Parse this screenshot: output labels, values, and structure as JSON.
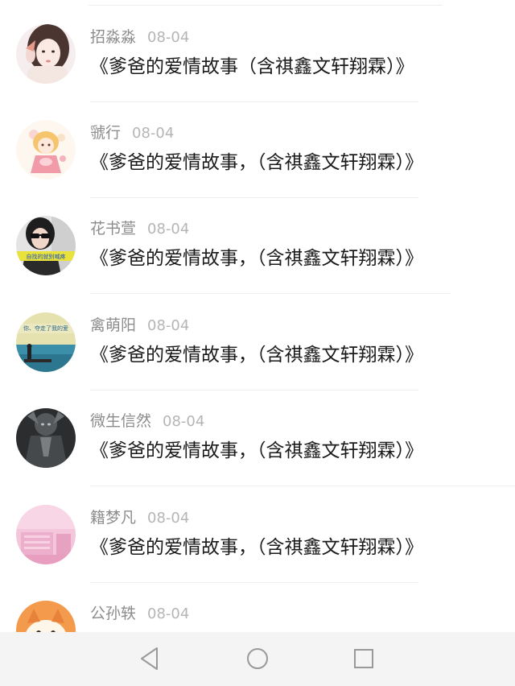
{
  "comments": [
    {
      "username": "招淼淼",
      "date": "08-04",
      "text": "《爹爸的爱情故事（含祺鑫文轩翔霖）》",
      "avatar_icon": "girl-portrait-avatar"
    },
    {
      "username": "虢行",
      "date": "08-04",
      "text": "《爹爸的爱情故事，（含祺鑫文轩翔霖）》",
      "avatar_icon": "cartoon-girl-avatar"
    },
    {
      "username": "花书萱",
      "date": "08-04",
      "text": "《爹爸的爱情故事，（含祺鑫文轩翔霖）》",
      "avatar_icon": "sunglasses-person-avatar",
      "avatar_caption": "自找的就别喊疼"
    },
    {
      "username": "禽萌阳",
      "date": "08-04",
      "text": "《爹爸的爱情故事，（含祺鑫文轩翔霖）》",
      "avatar_icon": "seaside-pier-avatar",
      "avatar_caption": "你、夺走了我的爱"
    },
    {
      "username": "微生信然",
      "date": "08-04",
      "text": "《爹爸的爱情故事，（含祺鑫文轩翔霖）》",
      "avatar_icon": "dark-warrior-avatar"
    },
    {
      "username": "籍梦凡",
      "date": "08-04",
      "text": "《爹爸的爱情故事，（含祺鑫文轩翔霖）》",
      "avatar_icon": "pink-room-avatar"
    },
    {
      "username": "公孙轶",
      "date": "08-04",
      "text": "",
      "avatar_icon": "orange-cartoon-animal-avatar"
    }
  ],
  "navigation": {
    "back_icon": "triangle-back-icon",
    "home_icon": "circle-home-icon",
    "recents_icon": "square-recents-icon"
  },
  "colors": {
    "username": "#8c8c8c",
    "date": "#b5b5b5",
    "comment_text": "#1a1a1a",
    "divider": "#ededed",
    "nav_bar_background": "#f4f4f4",
    "nav_icon": "#999999"
  }
}
